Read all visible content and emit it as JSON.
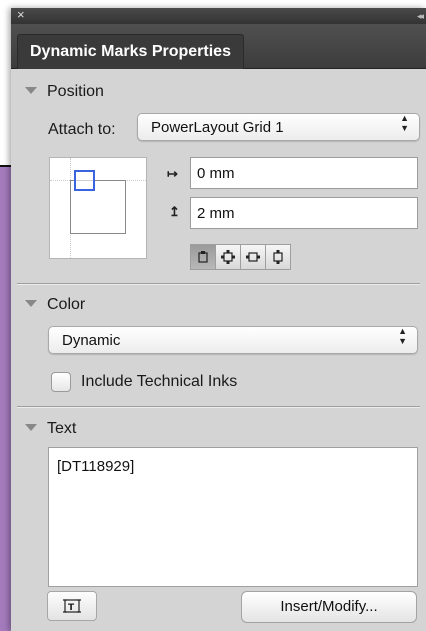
{
  "panel": {
    "close_glyph": "×",
    "collapse_glyph": "◂◂",
    "tab_title": "Dynamic Marks Properties"
  },
  "position": {
    "header": "Position",
    "attach_label": "Attach to:",
    "attach_value": "PowerLayout Grid 1",
    "x_offset": "0 mm",
    "y_offset": "2 mm",
    "x_offset_icon": "horizontal-offset-icon",
    "y_offset_icon": "vertical-offset-icon",
    "align_buttons": [
      "align-center-icon",
      "align-outside-all-icon",
      "align-outside-horizontal-icon",
      "align-outside-vertical-icon"
    ]
  },
  "color": {
    "header": "Color",
    "value": "Dynamic",
    "include_tech_inks_label": "Include Technical Inks",
    "include_tech_inks_checked": false
  },
  "text": {
    "header": "Text",
    "content": "[DT118929]",
    "variable_button_icon": "insert-variable-icon",
    "insert_modify_label": "Insert/Modify..."
  },
  "colors": {
    "panel_bg": "#d4d4d4",
    "tab_bar": "#3c3c3c",
    "position_handle": "#3a63e0",
    "background_page": "#a47bbd"
  }
}
